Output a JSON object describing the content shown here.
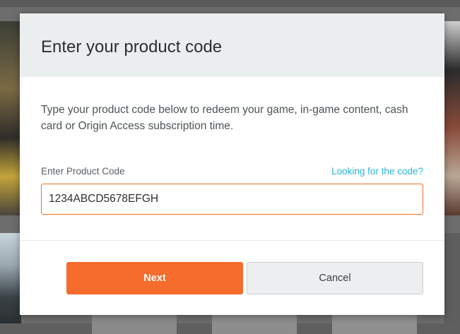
{
  "dialog": {
    "title": "Enter your product code",
    "description": "Type your product code below to redeem your game, in-game content, cash card or Origin Access subscription time.",
    "field_label": "Enter Product Code",
    "help_link": "Looking for the code?",
    "code_value": "1234ABCD5678EFGH",
    "next_label": "Next",
    "cancel_label": "Cancel"
  },
  "colors": {
    "accent": "#f56c2d",
    "link": "#26b7d6",
    "header_bg": "#ebeeef"
  }
}
